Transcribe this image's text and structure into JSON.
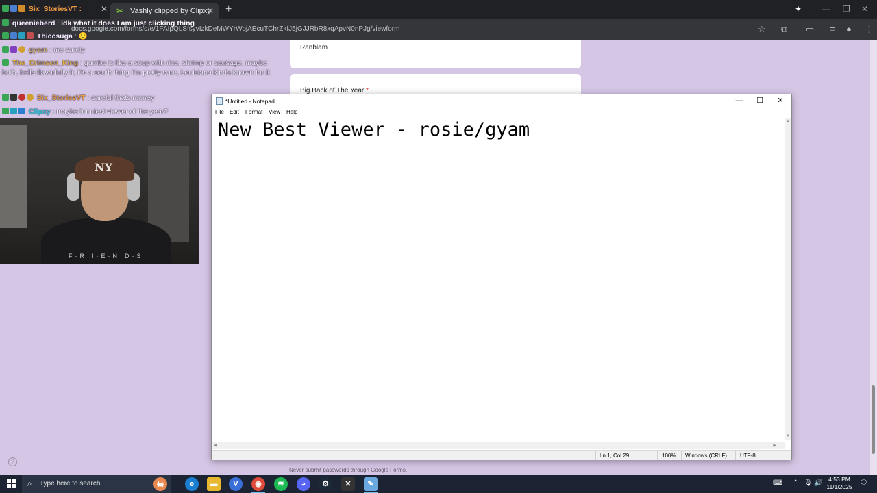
{
  "browser": {
    "tabs": [
      {
        "label": "Six_StoriesVT :",
        "active": false
      },
      {
        "label": "Vashly clipped by Clipxy",
        "active": true
      }
    ],
    "url": "docs.google.com/forms/d/e/1FAIpQLSfsyvIzkDeMWYrWojAEcuTChrZkfJ5jGJJRbR8xqApvN0nPJg/viewform"
  },
  "chat": [
    {
      "user": "queenieberd",
      "message": "idk what it does I am just clicking thing",
      "user_color": "#ffffff"
    },
    {
      "user": "Thiccsuga",
      "message": "🙂",
      "user_color": "#ffffff"
    },
    {
      "user": "gyam",
      "message": "me surely",
      "user_color": "#e6c070"
    },
    {
      "user": "The_Crimson_King",
      "message": "gumbo is like a soup with rice, shrimp or sausage, maybe both, hella flavorfully fr, it's a south thing I'm pretty sure, Louisiana kinda known for it",
      "user_color": "#e0b040"
    },
    {
      "user": "Six_StoriesVT",
      "message": "careful thats money",
      "user_color": "#f0a040"
    },
    {
      "user": "Clipxy",
      "message": "maybe funniest viewer of the year?",
      "user_color": "#40c8e0"
    }
  ],
  "webcam": {
    "cap_logo": "NY",
    "shirt_text": "F·R·I·E·N·D·S"
  },
  "form": {
    "option_text": "Ranblam",
    "question2": "Big Back of The Year",
    "required_mark": "*",
    "footer_note": "Never submit passwords through Google Forms."
  },
  "notepad": {
    "title": "*Untitled - Notepad",
    "menu": [
      "File",
      "Edit",
      "Format",
      "View",
      "Help"
    ],
    "content": "New Best Viewer - rosie/gyam",
    "status": {
      "position": "Ln 1, Col 29",
      "zoom": "100%",
      "line_endings": "Windows (CRLF)",
      "encoding": "UTF-8"
    }
  },
  "taskbar": {
    "search_placeholder": "Type here to search",
    "time": "4:53 PM",
    "date": "11/1/2025"
  }
}
